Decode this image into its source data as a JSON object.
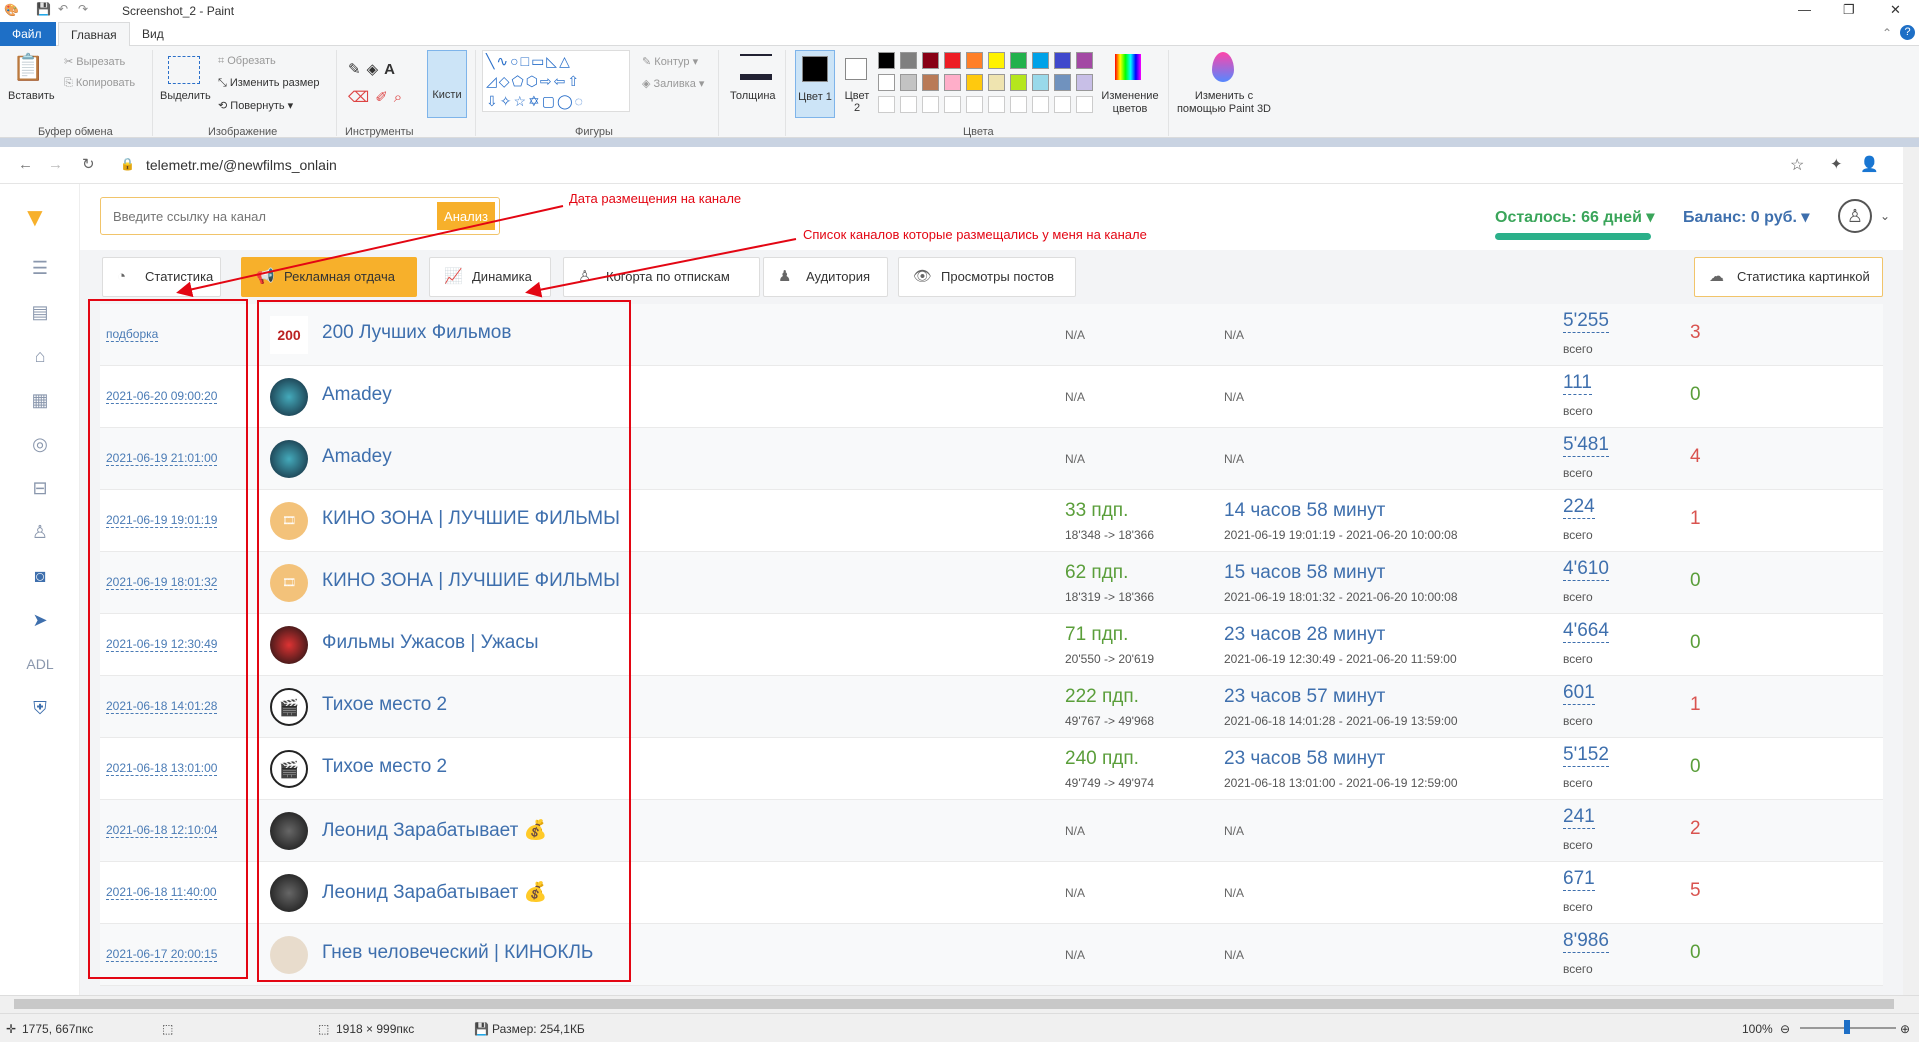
{
  "paint": {
    "title": "Screenshot_2 - Paint",
    "tabs": [
      "Файл",
      "Главная",
      "Вид"
    ],
    "clipboard": {
      "paste": "Вставить",
      "cut": "Вырезать",
      "copy": "Копировать",
      "group": "Буфер обмена"
    },
    "image": {
      "select": "Выделить",
      "crop": "Обрезать",
      "resize": "Изменить размер",
      "rotate": "Повернуть",
      "group": "Изображение"
    },
    "tools": {
      "group": "Инструменты",
      "brushes": "Кисти"
    },
    "shapes": {
      "group": "Фигуры",
      "outline": "Контур",
      "fill": "Заливка"
    },
    "thickness": "Толщина",
    "color1": "Цвет 1",
    "color2": "Цвет 2",
    "colors_group": "Цвета",
    "edit_colors": "Изменение цветов",
    "paint3d": "Изменить с помощью Paint 3D",
    "palette_row1": [
      "#000000",
      "#7f7f7f",
      "#880015",
      "#ed1c24",
      "#ff7f27",
      "#fff200",
      "#22b14c",
      "#00a2e8",
      "#3f48cc",
      "#a349a4"
    ],
    "palette_row2": [
      "#ffffff",
      "#c3c3c3",
      "#b97a57",
      "#ffaec9",
      "#ffc90e",
      "#efe4b0",
      "#b5e61d",
      "#99d9ea",
      "#7092be",
      "#c8bfe7"
    ],
    "status": {
      "cursor": "1775, 667пкс",
      "dimensions": "1918 × 999пкс",
      "size": "Размер: 254,1КБ",
      "zoom": "100%"
    }
  },
  "browser": {
    "url": "telemetr.me/@newfilms_onlain"
  },
  "page": {
    "search_placeholder": "Введите ссылку на канал",
    "analyze": "Анализ",
    "remaining": "Осталось: 66 дней",
    "balance": "Баланс: 0 руб.",
    "sidebar_adl": "ADL",
    "tabs": [
      "Статистика",
      "Рекламная отдача",
      "Динамика",
      "Когорта по отпискам",
      "Аудитория",
      "Просмотры постов"
    ],
    "active_tab": "Рекламная отдача",
    "stats_image": "Статистика картинкой",
    "views_sub": "всего",
    "rows": [
      {
        "date": "подборка",
        "name": "200 Лучших Фильмов",
        "pdp": "N/A",
        "pdp_sub": "",
        "time": "N/A",
        "time_sub": "",
        "views": "5'255",
        "count": "3",
        "count_color": "#d9534f",
        "avatar": "film"
      },
      {
        "date": "2021-06-20 09:00:20",
        "name": "Amadey",
        "pdp": "N/A",
        "pdp_sub": "",
        "time": "N/A",
        "time_sub": "",
        "views": "111",
        "count": "0",
        "count_color": "#5a9e3a",
        "avatar": "dark"
      },
      {
        "date": "2021-06-19 21:01:00",
        "name": "Amadey",
        "pdp": "N/A",
        "pdp_sub": "",
        "time": "N/A",
        "time_sub": "",
        "views": "5'481",
        "count": "4",
        "count_color": "#d9534f",
        "avatar": "dark"
      },
      {
        "date": "2021-06-19 19:01:19",
        "name": "КИНО ЗОНА | ЛУЧШИЕ ФИЛЬМЫ",
        "pdp": "33 пдп.",
        "pdp_sub": "18'348 -> 18'366",
        "time": "14 часов 58 минут",
        "time_sub": "2021-06-19 19:01:19 - 2021-06-20 10:00:08",
        "views": "224",
        "count": "1",
        "count_color": "#d9534f",
        "avatar": "kino"
      },
      {
        "date": "2021-06-19 18:01:32",
        "name": "КИНО ЗОНА | ЛУЧШИЕ ФИЛЬМЫ",
        "pdp": "62 пдп.",
        "pdp_sub": "18'319 -> 18'366",
        "time": "15 часов 58 минут",
        "time_sub": "2021-06-19 18:01:32 - 2021-06-20 10:00:08",
        "views": "4'610",
        "count": "0",
        "count_color": "#5a9e3a",
        "avatar": "kino"
      },
      {
        "date": "2021-06-19 12:30:49",
        "name": "Фильмы Ужасов | Ужасы",
        "pdp": "71 пдп.",
        "pdp_sub": "20'550 -> 20'619",
        "time": "23 часов 28 минут",
        "time_sub": "2021-06-19 12:30:49 - 2021-06-20 11:59:00",
        "views": "4'664",
        "count": "0",
        "count_color": "#5a9e3a",
        "avatar": "horror"
      },
      {
        "date": "2021-06-18 14:01:28",
        "name": "Тихое место 2",
        "pdp": "222 пдп.",
        "pdp_sub": "49'767 -> 49'968",
        "time": "23 часов 57 минут",
        "time_sub": "2021-06-18 14:01:28 - 2021-06-19 13:59:00",
        "views": "601",
        "count": "1",
        "count_color": "#d9534f",
        "avatar": "clap"
      },
      {
        "date": "2021-06-18 13:01:00",
        "name": "Тихое место 2",
        "pdp": "240 пдп.",
        "pdp_sub": "49'749 -> 49'974",
        "time": "23 часов 58 минут",
        "time_sub": "2021-06-18 13:01:00 - 2021-06-19 12:59:00",
        "views": "5'152",
        "count": "0",
        "count_color": "#5a9e3a",
        "avatar": "clap"
      },
      {
        "date": "2021-06-18 12:10:04",
        "name": "Леонид Зарабатывает 💰",
        "pdp": "N/A",
        "pdp_sub": "",
        "time": "N/A",
        "time_sub": "",
        "views": "241",
        "count": "2",
        "count_color": "#d9534f",
        "avatar": "leonid"
      },
      {
        "date": "2021-06-18 11:40:00",
        "name": "Леонид Зарабатывает 💰",
        "pdp": "N/A",
        "pdp_sub": "",
        "time": "N/A",
        "time_sub": "",
        "views": "671",
        "count": "5",
        "count_color": "#d9534f",
        "avatar": "leonid"
      },
      {
        "date": "2021-06-17 20:00:15",
        "name": "Гнев человеческий | КИНОКЛЬ",
        "pdp": "N/A",
        "pdp_sub": "",
        "time": "N/A",
        "time_sub": "",
        "views": "8'986",
        "count": "0",
        "count_color": "#5a9e3a",
        "avatar": "gnev"
      }
    ]
  },
  "annotations": {
    "date_label": "Дата размещения на канале",
    "channels_label": "Список каналов которые размещались у меня на канале",
    "color": "#e30613"
  }
}
